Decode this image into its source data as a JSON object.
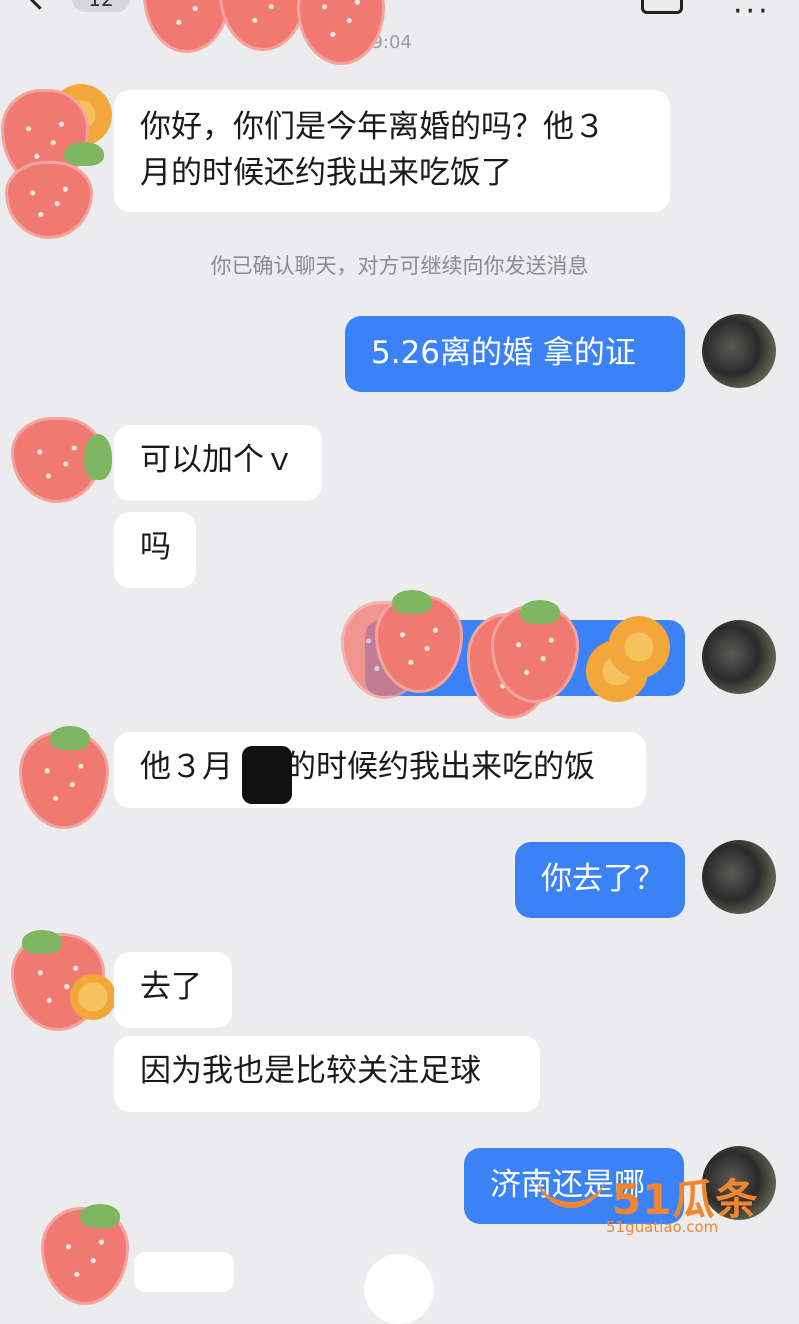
{
  "header": {
    "back_count": "12",
    "timestamp": "09:04",
    "more_label": "···"
  },
  "system_notice": "你已确认聊天，对方可继续向你发送消息",
  "messages": [
    {
      "side": "in",
      "text_line1": "你好，你们是今年离婚的吗？他３",
      "text_line2": "月的时候还约我出来吃饭了"
    },
    {
      "side": "out",
      "text": "5.26离的婚 拿的证"
    },
    {
      "side": "in",
      "text": "可以加个ｖ"
    },
    {
      "side": "in",
      "text": "吗"
    },
    {
      "side": "out",
      "text": "",
      "obscured": true
    },
    {
      "side": "in",
      "text_before": "他３月",
      "text_after": "的时候约我出来吃的饭"
    },
    {
      "side": "out",
      "text": "你去了？"
    },
    {
      "side": "in",
      "text": "去了"
    },
    {
      "side": "in",
      "text": "因为我也是比较关注足球"
    },
    {
      "side": "out",
      "text": "济南还是哪"
    }
  ],
  "watermark": {
    "brand": "51瓜条",
    "url": "51guatiao.com"
  },
  "colors": {
    "background": "#ececef",
    "outgoing_bubble": "#3c82f7",
    "incoming_bubble": "#ffffff",
    "watermark": "#f0862f"
  }
}
